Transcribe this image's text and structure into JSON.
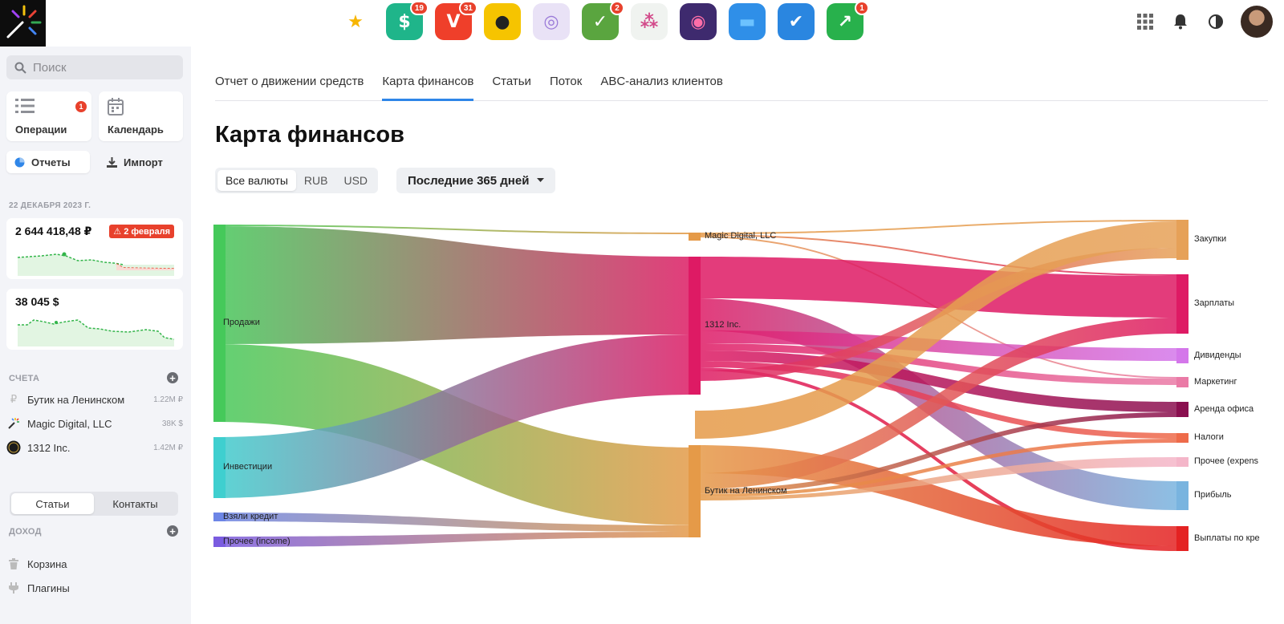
{
  "topbar": {
    "apps": [
      {
        "icon": "star-app-icon",
        "glyph": "★",
        "bg": "#ffffff",
        "fg": "#f7b500",
        "badge": ""
      },
      {
        "icon": "dollar-app-icon",
        "glyph": "$",
        "bg": "#1fb58a",
        "fg": "#ffffff",
        "badge": "19"
      },
      {
        "icon": "vivaldi-app-icon",
        "glyph": "V",
        "bg": "#ef3f2a",
        "fg": "#ffffff",
        "badge": "31"
      },
      {
        "icon": "camera-app-icon",
        "glyph": "●",
        "bg": "#f6c400",
        "fg": "#222222",
        "badge": ""
      },
      {
        "icon": "spiral-app-icon",
        "glyph": "◎",
        "bg": "#e9e2f6",
        "fg": "#9a7ad8",
        "badge": ""
      },
      {
        "icon": "tasks-app-icon",
        "glyph": "✓",
        "bg": "#5aa53f",
        "fg": "#ffffff",
        "badge": "2"
      },
      {
        "icon": "dots-app-icon",
        "glyph": "⁂",
        "bg": "#f0f3f0",
        "fg": "#d24a8a",
        "badge": ""
      },
      {
        "icon": "lens-app-icon",
        "glyph": "◉",
        "bg": "#3e2a6e",
        "fg": "#ff6ea8",
        "badge": ""
      },
      {
        "icon": "folder-app-icon",
        "glyph": "▬",
        "bg": "#2f8fe8",
        "fg": "#6cc2ff",
        "badge": ""
      },
      {
        "icon": "chat-check-app-icon",
        "glyph": "✔",
        "bg": "#2a86e0",
        "fg": "#ffffff",
        "badge": ""
      },
      {
        "icon": "chart-app-icon",
        "glyph": "↗",
        "bg": "#28b14c",
        "fg": "#ffffff",
        "badge": "1"
      }
    ]
  },
  "sidebar": {
    "search_placeholder": "Поиск",
    "tiles": {
      "operations": "Операции",
      "operations_badge": "1",
      "calendar": "Календарь",
      "reports": "Отчеты",
      "import": "Импорт"
    },
    "date_header": "22 ДЕКАБРЯ 2023 Г.",
    "balances": [
      {
        "amount": "2 644 418,48 ₽",
        "warning": "2 февраля"
      },
      {
        "amount": "38 045 $"
      }
    ],
    "accounts_header": "СЧЕТА",
    "accounts": [
      {
        "name": "Бутик на Ленинском",
        "value": "1.22M ₽",
        "icon": "ruble-icon"
      },
      {
        "name": "Magic Digital, LLC",
        "value": "38K $",
        "icon": "wand-icon"
      },
      {
        "name": "1312 Inc.",
        "value": "1.42M ₽",
        "icon": "circle-logo-icon"
      }
    ],
    "segment": {
      "left": "Статьи",
      "right": "Контакты"
    },
    "income_header": "ДОХОД",
    "bottom": [
      {
        "name": "Корзина",
        "icon": "trash-icon"
      },
      {
        "name": "Плагины",
        "icon": "plug-icon"
      }
    ]
  },
  "main": {
    "tabs": [
      "Отчет о движении средств",
      "Карта финансов",
      "Статьи",
      "Поток",
      "ABC-анализ клиентов"
    ],
    "active_tab": 1,
    "title": "Карта финансов",
    "currencies": [
      "Все валюты",
      "RUB",
      "USD"
    ],
    "active_currency": 0,
    "period": "Последние 365 дней"
  },
  "chart_data": {
    "type": "sankey",
    "sources": [
      "Продажи",
      "Инвестиции",
      "Взяли кредит",
      "Прочее (income)"
    ],
    "accounts": [
      "Magic Digital, LLC",
      "1312 Inc.",
      "Бутик на Ленинском"
    ],
    "targets": [
      "Закупки",
      "Зарплаты",
      "Дивиденды",
      "Маркетинг",
      "Аренда офиса",
      "Налоги",
      "Прочее (expens",
      "Прибыль",
      "Выплаты по кре"
    ],
    "colors": {
      "Продажи": "#45c95a",
      "Инвестиции": "#3fcfcf",
      "Взяли кредит": "#6d86e6",
      "Прочее (income)": "#7a5ce0",
      "Magic Digital, LLC": "#e59a48",
      "1312 Inc.": "#de1a64",
      "Бутик на Ленинском": "#e59a48",
      "Закупки": "#e6a158",
      "Зарплаты": "#de1a64",
      "Дивиденды": "#d477ea",
      "Маркетинг": "#ea7aa6",
      "Аренда офиса": "#8a0f4f",
      "Налоги": "#ee6b4a",
      "Прочее (expens": "#f4b6c9",
      "Прибыль": "#79b4df",
      "Выплаты по кре": "#e42222"
    }
  }
}
